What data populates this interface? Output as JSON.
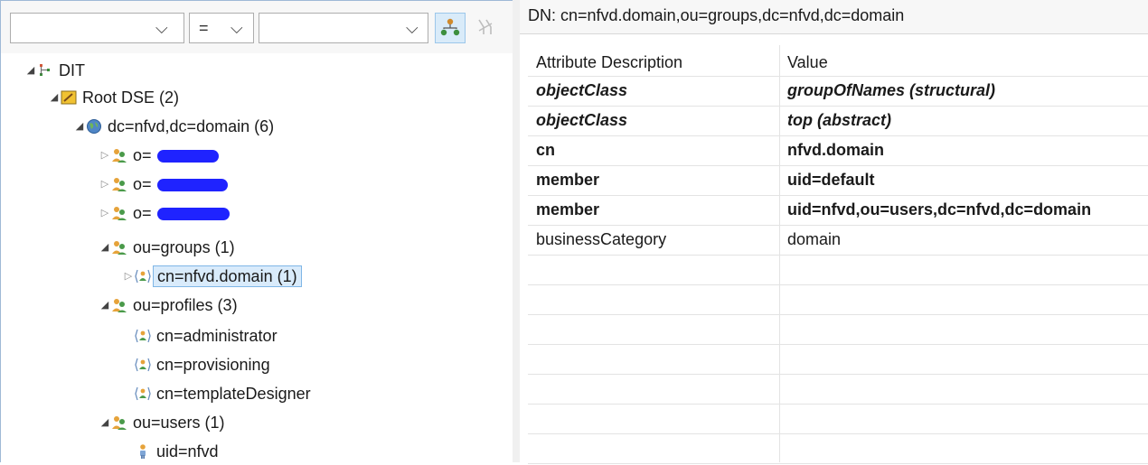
{
  "filter": {
    "attribute_value": "",
    "operator_value": "=",
    "value_value": ""
  },
  "tree": {
    "root_label": "DIT",
    "root_dse_label": "Root DSE (2)",
    "base_label": "dc=nfvd,dc=domain (6)",
    "hidden_1_label": "o=",
    "hidden_2_label": "o=",
    "hidden_3_label": "o=",
    "groups_label": "ou=groups (1)",
    "group_entry_label": "cn=nfvd.domain (1)",
    "profiles_label": "ou=profiles (3)",
    "profile_1_label": "cn=administrator",
    "profile_2_label": "cn=provisioning",
    "profile_3_label": "cn=templateDesigner",
    "users_label": "ou=users (1)",
    "user_1_label": "uid=nfvd"
  },
  "entry": {
    "dn_label": "DN: cn=nfvd.domain,ou=groups,dc=nfvd,dc=domain",
    "columns": {
      "attribute": "Attribute Description",
      "value": "Value"
    },
    "rows": [
      {
        "attribute": "objectClass",
        "value": "groupOfNames (structural)"
      },
      {
        "attribute": "objectClass",
        "value": "top (abstract)"
      },
      {
        "attribute": "cn",
        "value": "nfvd.domain"
      },
      {
        "attribute": "member",
        "value": "uid=default"
      },
      {
        "attribute": "member",
        "value": "uid=nfvd,ou=users,dc=nfvd,dc=domain"
      },
      {
        "attribute": "businessCategory",
        "value": "domain"
      }
    ]
  },
  "colors": {
    "selection": "#d9ebfb",
    "selection_border": "#7fb6e6",
    "redaction": "#1f23ff"
  }
}
